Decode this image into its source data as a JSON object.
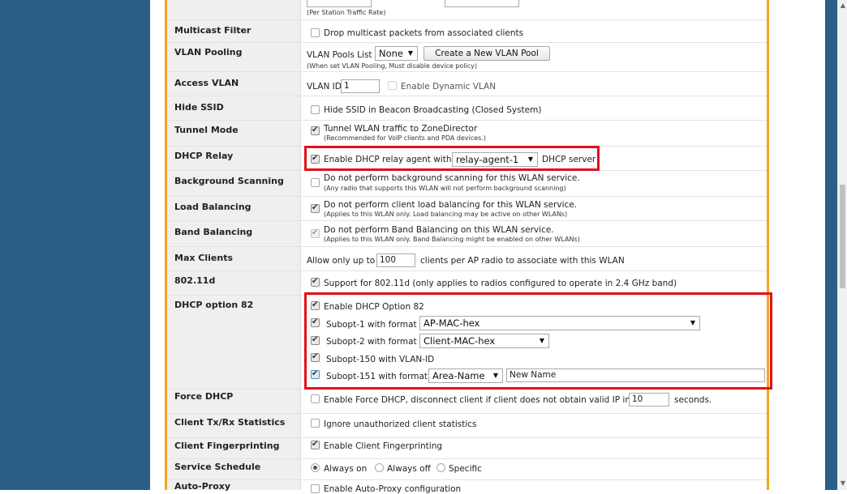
{
  "top": {
    "note": "(Per Station Traffic Rate)"
  },
  "rows": {
    "multicast": {
      "label": "Multicast Filter",
      "text": "Drop multicast packets from associated clients"
    },
    "vlan_pooling": {
      "label": "VLAN Pooling",
      "prefix": "VLAN Pools List",
      "select": "None",
      "button": "Create a New VLAN Pool",
      "note": "(When set VLAN Pooling, Must disable device policy)"
    },
    "access_vlan": {
      "label": "Access VLAN",
      "prefix": "VLAN ID",
      "value": "1",
      "dynamic": "Enable Dynamic VLAN"
    },
    "hide_ssid": {
      "label": "Hide SSID",
      "text": "Hide SSID in Beacon Broadcasting (Closed System)"
    },
    "tunnel": {
      "label": "Tunnel Mode",
      "text": "Tunnel WLAN traffic to ZoneDirector",
      "note": "(Recommended for VoIP clients and PDA devices.)"
    },
    "dhcp_relay": {
      "label": "DHCP Relay",
      "text": "Enable DHCP relay agent with",
      "select": "relay-agent-1",
      "suffix": "DHCP server"
    },
    "bg_scan": {
      "label": "Background Scanning",
      "text": "Do not perform background scanning for this WLAN service.",
      "note": "(Any radio that supports this WLAN will not perform background scanning)"
    },
    "load_bal": {
      "label": "Load Balancing",
      "text": "Do not perform client load balancing for this WLAN service.",
      "note": "(Applies to this WLAN only. Load balancing may be active on other WLANs)"
    },
    "band_bal": {
      "label": "Band Balancing",
      "text": "Do not perform Band Balancing on this WLAN service.",
      "note": "(Applies to this WLAN only. Band Balancing might be enabled on other WLANs)"
    },
    "max_clients": {
      "label": "Max Clients",
      "prefix": "Allow only up to",
      "value": "100",
      "suffix": "clients per AP radio to associate with this WLAN"
    },
    "dot11d": {
      "label": "802.11d",
      "text": "Support for 802.11d (only applies to radios configured to operate in 2.4 GHz band)"
    },
    "opt82": {
      "label": "DHCP option 82",
      "enable": "Enable DHCP Option 82",
      "sub1": "Subopt-1 with format",
      "sub1_select": "AP-MAC-hex",
      "sub2": "Subopt-2 with format",
      "sub2_select": "Client-MAC-hex",
      "sub150": "Subopt-150 with VLAN-ID",
      "sub151": "Subopt-151 with format",
      "sub151_select": "Area-Name",
      "sub151_value": "New Name"
    },
    "force_dhcp": {
      "label": "Force DHCP",
      "text": "Enable Force DHCP, disconnect client if client does not obtain valid IP in",
      "value": "10",
      "suffix": "seconds."
    },
    "txrx": {
      "label": "Client Tx/Rx Statistics",
      "text": "Ignore unauthorized client statistics"
    },
    "fingerprint": {
      "label": "Client Fingerprinting",
      "text": "Enable Client Fingerprinting"
    },
    "schedule": {
      "label": "Service Schedule",
      "opt1": "Always on",
      "opt2": "Always off",
      "opt3": "Specific"
    },
    "autoproxy": {
      "label": "Auto-Proxy",
      "text": "Enable Auto-Proxy configuration"
    }
  },
  "colors": {
    "sidebar": "#2b5f8a",
    "accent": "#f5a623",
    "highlight": "#e2111b"
  }
}
